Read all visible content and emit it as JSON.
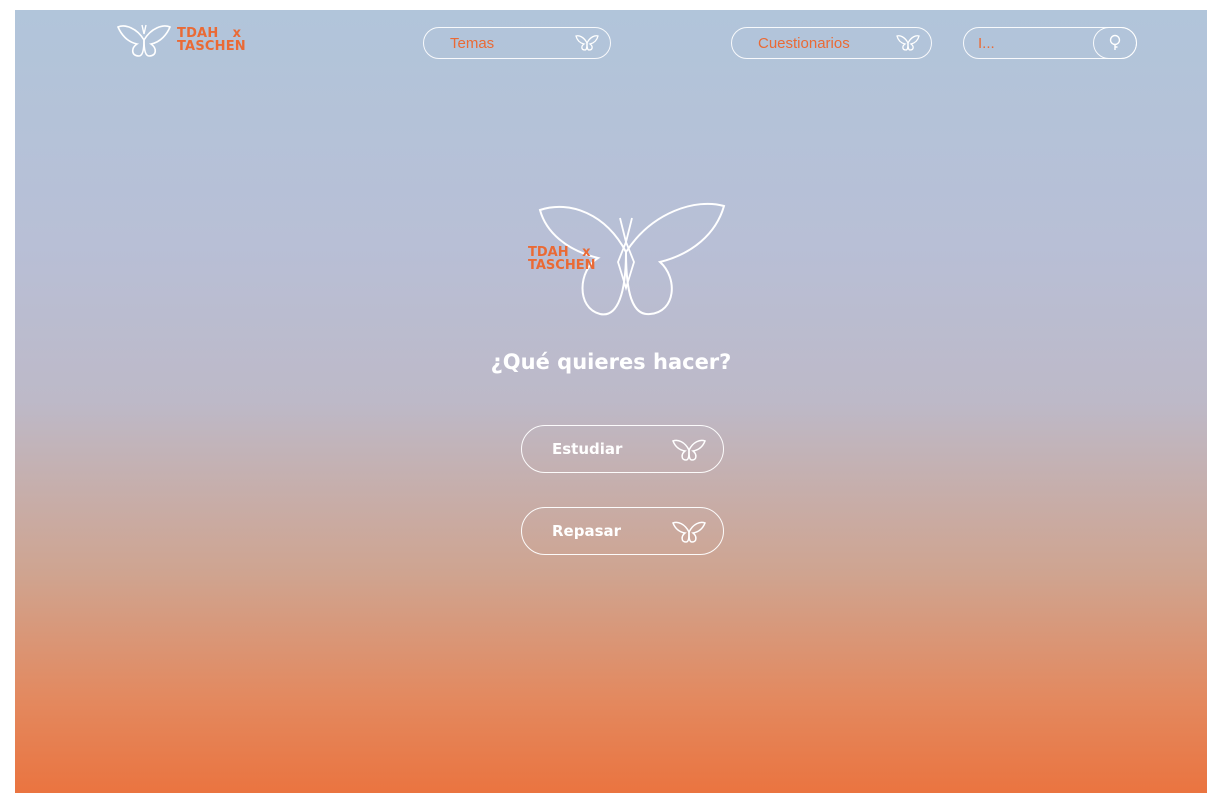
{
  "header": {
    "brand_line1": "TDAH   x",
    "brand_line2": "TASCHEN",
    "nav": {
      "temas_label": "Temas",
      "cuestionarios_label": "Cuestionarios"
    },
    "search": {
      "value": "I...",
      "icon": "search-icon"
    }
  },
  "hero": {
    "brand_line1": "TDAH   x",
    "brand_line2": "TASCHEN",
    "question": "¿Qué quieres hacer?"
  },
  "actions": {
    "study_label": "Estudiar",
    "review_label": "Repasar"
  },
  "icons": {
    "nav_button": "butterfly-icon",
    "logo": "butterfly-logo-icon"
  },
  "colors": {
    "accent": "#ea6a35",
    "outline": "#ffffff",
    "gradient_top": "#b1c5da",
    "gradient_bottom": "#ea7440"
  }
}
